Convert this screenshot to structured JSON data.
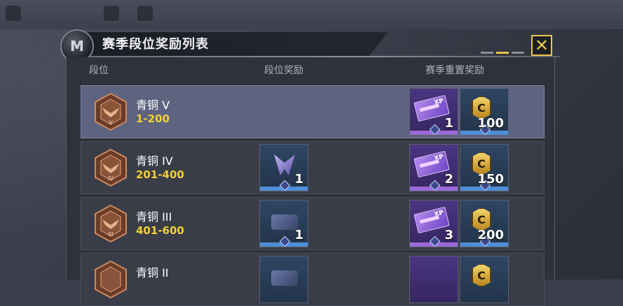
{
  "header": {
    "badge_letter": "M",
    "title": "赛季段位奖励列表",
    "close_symbol": "✕"
  },
  "columns": {
    "rank": "段位",
    "rank_reward": "段位奖励",
    "season_reset_reward": "赛季重置奖励"
  },
  "rows": [
    {
      "rank_name": "青铜 V",
      "numeral": "V",
      "range": "1-200",
      "selected": true,
      "rank_reward": null,
      "xp_qty": "1",
      "cp_qty": "100"
    },
    {
      "rank_name": "青铜 IV",
      "numeral": "IV",
      "range": "201-400",
      "selected": false,
      "rank_reward": {
        "qty": "1",
        "icon": "wing-emblem-icon"
      },
      "xp_qty": "2",
      "cp_qty": "150"
    },
    {
      "rank_name": "青铜 III",
      "numeral": "III",
      "range": "401-600",
      "selected": false,
      "rank_reward": {
        "qty": "1",
        "icon": "weapon-charm-icon"
      },
      "xp_qty": "3",
      "cp_qty": "200"
    },
    {
      "rank_name": "青铜 II",
      "numeral": "II",
      "range": "",
      "selected": false,
      "rank_reward": {
        "qty": "",
        "icon": "weapon-charm-icon"
      },
      "xp_qty": "",
      "cp_qty": ""
    }
  ],
  "colors": {
    "accent_gold": "#e6c74a",
    "range_yellow": "#f0cf3a",
    "selected_row": "#5e6480",
    "purple_rarity": "#9a6ad8",
    "blue_rarity": "#4e8fd6"
  }
}
